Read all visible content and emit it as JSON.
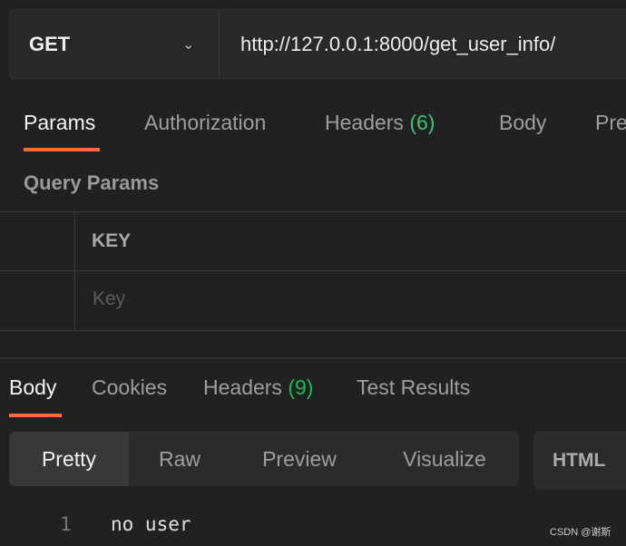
{
  "request": {
    "method": "GET",
    "url": "http://127.0.0.1:8000/get_user_info/"
  },
  "request_tabs": [
    {
      "label": "Params"
    },
    {
      "label": "Authorization"
    },
    {
      "label": "Headers",
      "count": "(6)"
    },
    {
      "label": "Body"
    },
    {
      "label": "Pre"
    }
  ],
  "query_params": {
    "title": "Query Params",
    "key_header": "KEY",
    "key_placeholder": "Key"
  },
  "response_tabs": [
    {
      "label": "Body"
    },
    {
      "label": "Cookies"
    },
    {
      "label": "Headers",
      "count": "(9)"
    },
    {
      "label": "Test Results"
    }
  ],
  "view_modes": [
    "Pretty",
    "Raw",
    "Preview",
    "Visualize"
  ],
  "format": "HTML",
  "response_body": {
    "line_number": "1",
    "content": "no user"
  },
  "watermark": "CSDN @谢斯",
  "colors": {
    "accent": "#ff6c37",
    "count_green": "#3fbf7a",
    "background": "#212121"
  }
}
